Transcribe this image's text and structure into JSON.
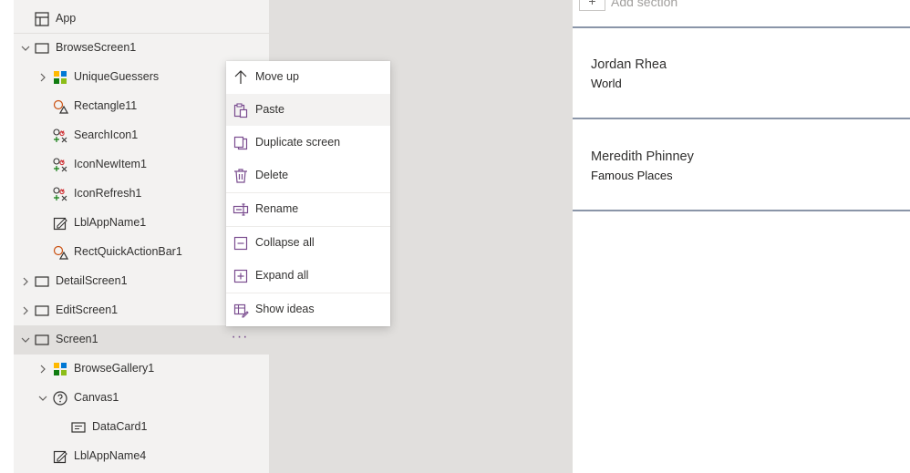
{
  "tree": {
    "app_label": "App",
    "nodes": [
      {
        "label": "BrowseScreen1",
        "icon": "screen-icon",
        "expanded": true
      },
      {
        "label": "UniqueGuessers",
        "icon": "gallery-icon",
        "expanded": false
      },
      {
        "label": "Rectangle11",
        "icon": "shape-icon"
      },
      {
        "label": "SearchIcon1",
        "icon": "icons-control-icon"
      },
      {
        "label": "IconNewItem1",
        "icon": "icons-control-icon"
      },
      {
        "label": "IconRefresh1",
        "icon": "icons-control-icon"
      },
      {
        "label": "LblAppName1",
        "icon": "label-icon"
      },
      {
        "label": "RectQuickActionBar1",
        "icon": "shape-icon"
      },
      {
        "label": "DetailScreen1",
        "icon": "screen-icon",
        "expanded": false
      },
      {
        "label": "EditScreen1",
        "icon": "screen-icon",
        "expanded": false
      },
      {
        "label": "Screen1",
        "icon": "screen-icon",
        "expanded": true,
        "selected": true
      },
      {
        "label": "BrowseGallery1",
        "icon": "gallery-icon",
        "expanded": false
      },
      {
        "label": "Canvas1",
        "icon": "canvas-icon",
        "expanded": true
      },
      {
        "label": "DataCard1",
        "icon": "datacard-icon"
      },
      {
        "label": "LblAppName4",
        "icon": "label-icon"
      }
    ],
    "more_button": "···"
  },
  "context_menu": {
    "items": [
      {
        "label": "Move up",
        "icon": "arrow-up-icon"
      },
      {
        "label": "Paste",
        "icon": "paste-icon"
      },
      {
        "label": "Duplicate screen",
        "icon": "duplicate-icon"
      },
      {
        "label": "Delete",
        "icon": "trash-icon"
      },
      {
        "label": "Rename",
        "icon": "rename-icon"
      },
      {
        "label": "Collapse all",
        "icon": "collapse-icon"
      },
      {
        "label": "Expand all",
        "icon": "expand-icon"
      },
      {
        "label": "Show ideas",
        "icon": "ideas-icon"
      }
    ],
    "hovered": "Paste"
  },
  "preview": {
    "add_section_label": "Add section",
    "add_icon": "+",
    "cards": [
      {
        "title": "Jordan Rhea",
        "subtitle": "World"
      },
      {
        "title": "Meredith Phinney",
        "subtitle": "Famous Places"
      }
    ],
    "divider_color": "#8a95a8"
  },
  "colors": {
    "accent": "#7a4d8f",
    "tree_bg": "#f3f2f1",
    "canvas_bg": "#e1dfdd",
    "selected_row": "#e1dfdd"
  }
}
